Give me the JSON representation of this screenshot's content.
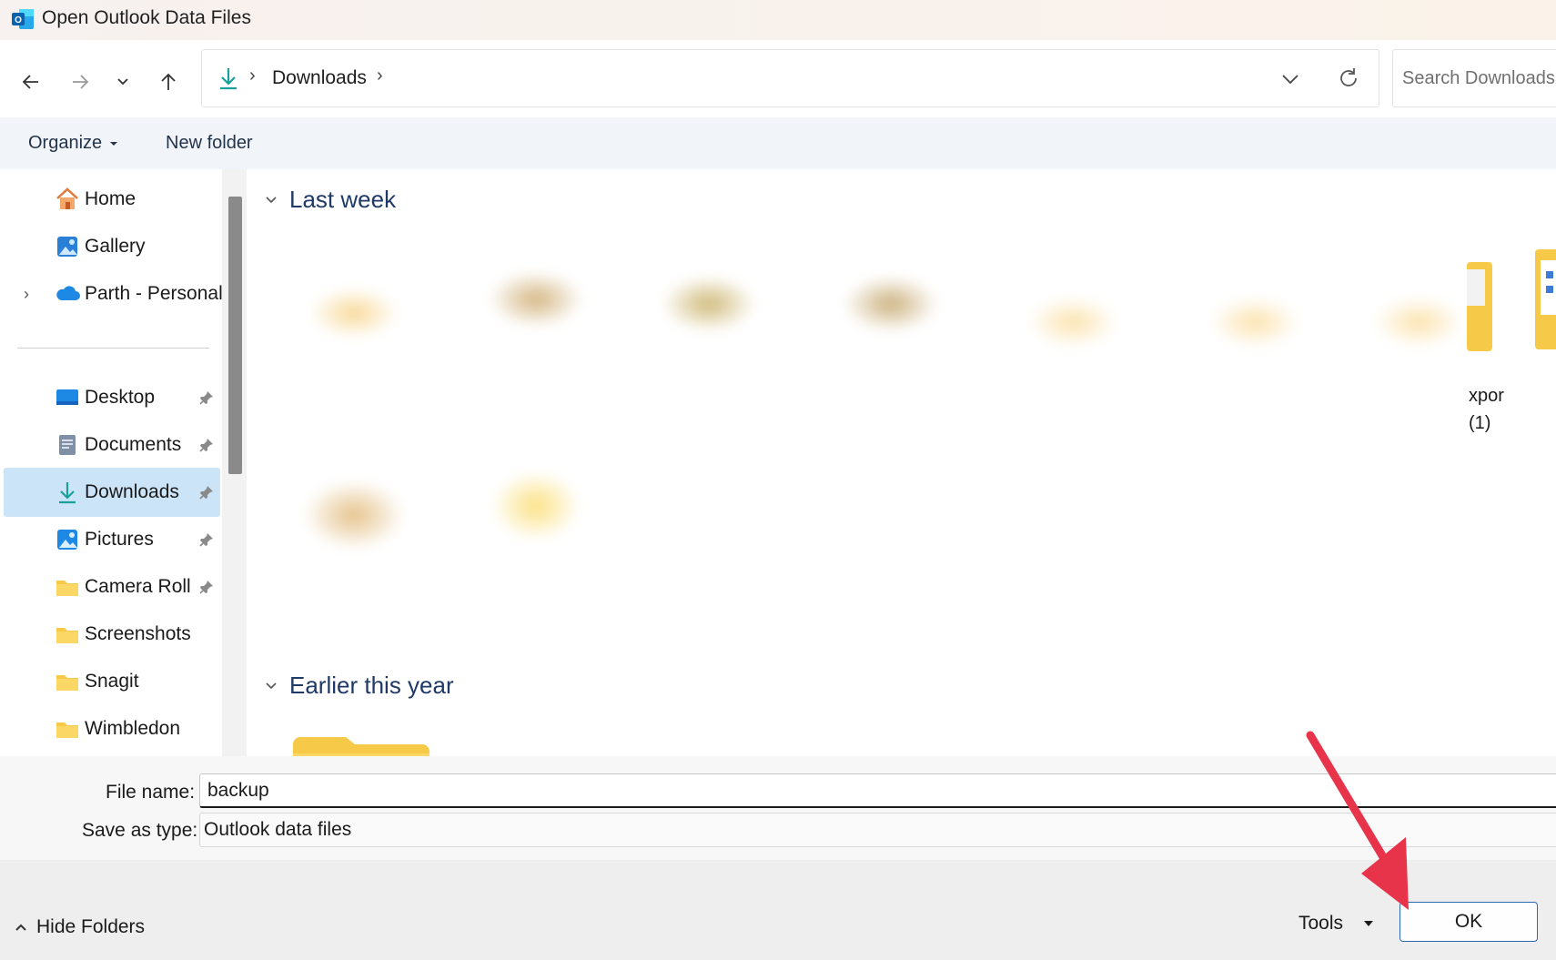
{
  "window": {
    "title": "Open Outlook Data Files"
  },
  "address_bar": {
    "crumb": "Downloads",
    "separator": "›"
  },
  "search": {
    "placeholder": "Search Downloads"
  },
  "command_bar": {
    "organize_label": "Organize",
    "new_folder_label": "New folder"
  },
  "sidebar": {
    "quick_items": [
      {
        "label": "Home",
        "icon": "home-icon"
      },
      {
        "label": "Gallery",
        "icon": "gallery-icon"
      },
      {
        "label": "Parth - Personal",
        "icon": "onedrive-cloud-icon"
      }
    ],
    "pinned_items": [
      {
        "label": "Desktop",
        "icon": "desktop-icon",
        "pinned": true
      },
      {
        "label": "Documents",
        "icon": "documents-icon",
        "pinned": true
      },
      {
        "label": "Downloads",
        "icon": "downloads-icon",
        "pinned": true,
        "selected": true
      },
      {
        "label": "Pictures",
        "icon": "pictures-icon",
        "pinned": true
      },
      {
        "label": "Camera Roll",
        "icon": "folder-icon",
        "pinned": true
      },
      {
        "label": "Screenshots",
        "icon": "folder-icon",
        "pinned": false
      },
      {
        "label": "Snagit",
        "icon": "folder-icon",
        "pinned": false
      },
      {
        "label": "Wimbledon",
        "icon": "folder-icon",
        "pinned": false
      }
    ]
  },
  "content": {
    "groups": [
      {
        "title": "Last week"
      },
      {
        "title": "Earlier this year"
      }
    ],
    "visible_fragments": [
      "xpor",
      "(1)"
    ]
  },
  "form": {
    "file_name_label": "File name:",
    "file_name_value": "backup",
    "type_label": "Save as type:",
    "type_value": "Outlook data files"
  },
  "footer": {
    "hide_folders_label": "Hide Folders",
    "tools_label": "Tools",
    "ok_label": "OK"
  },
  "colors": {
    "accent": "#2c69b3",
    "selection": "#cce4f7",
    "folder": "#f7c948",
    "annotation_arrow": "#e8344a"
  }
}
